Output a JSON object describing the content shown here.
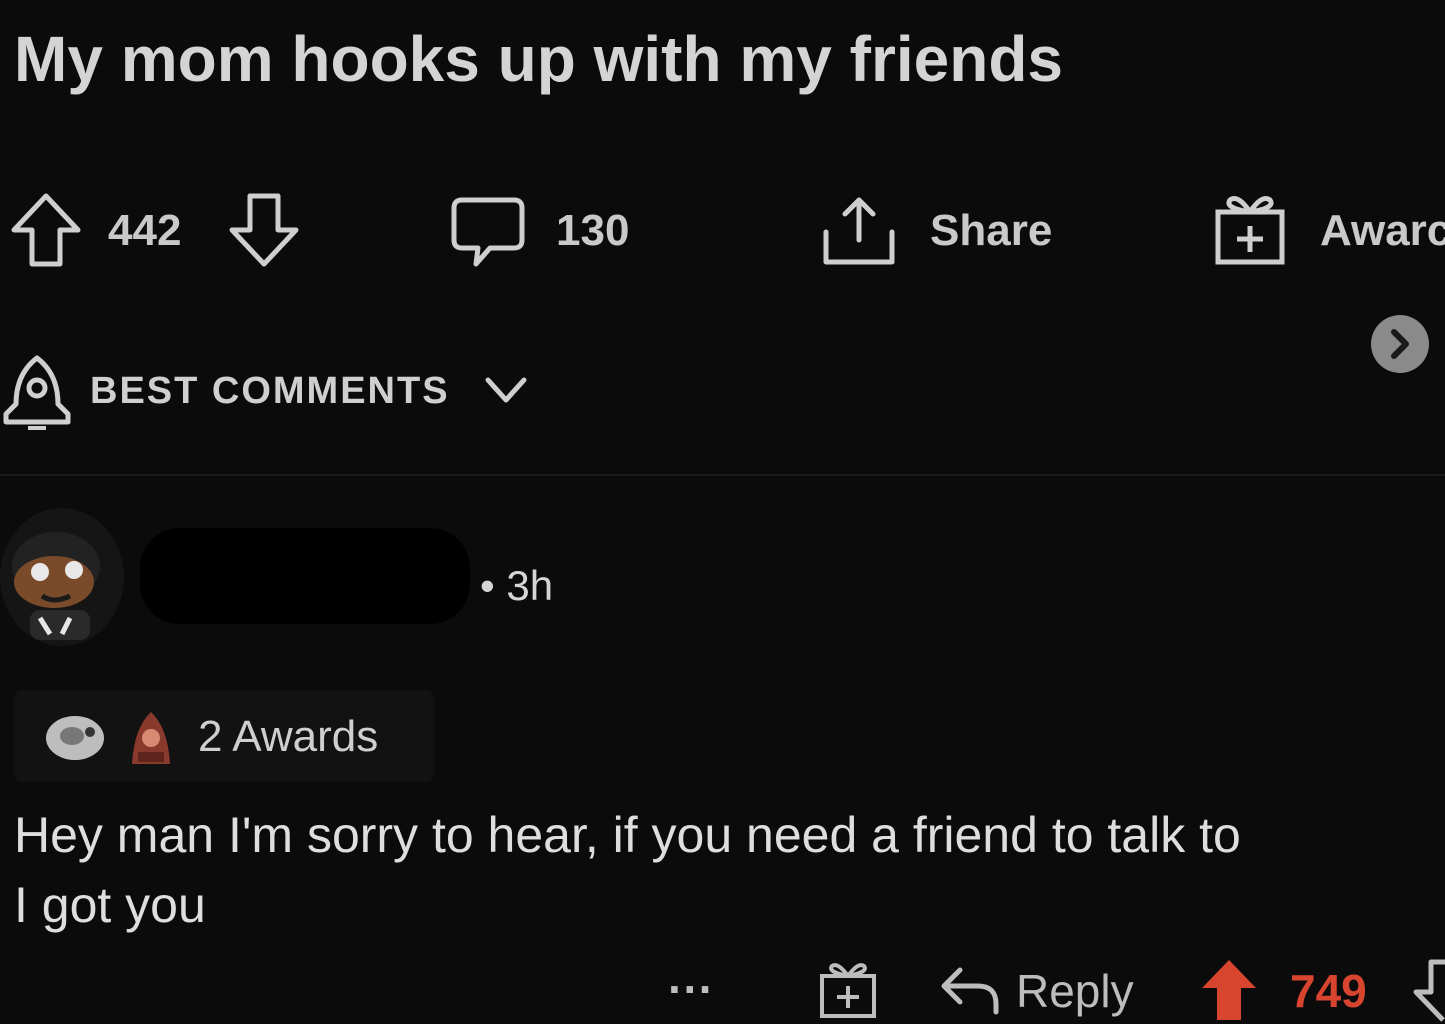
{
  "post": {
    "title": "My mom hooks up with my friends",
    "score": "442",
    "comments_count": "130",
    "share_label": "Share",
    "award_label": "Awarc"
  },
  "sort": {
    "label": "BEST COMMENTS"
  },
  "comment": {
    "time": "• 3h",
    "awards_label": "2 Awards",
    "text": "Hey man I'm sorry to hear, if you need a friend to talk to\nI got you",
    "more_label": "···",
    "reply_label": "Reply",
    "score": "749"
  },
  "colors": {
    "background": "#0b0b0c",
    "upvoted": "#d8452f"
  }
}
